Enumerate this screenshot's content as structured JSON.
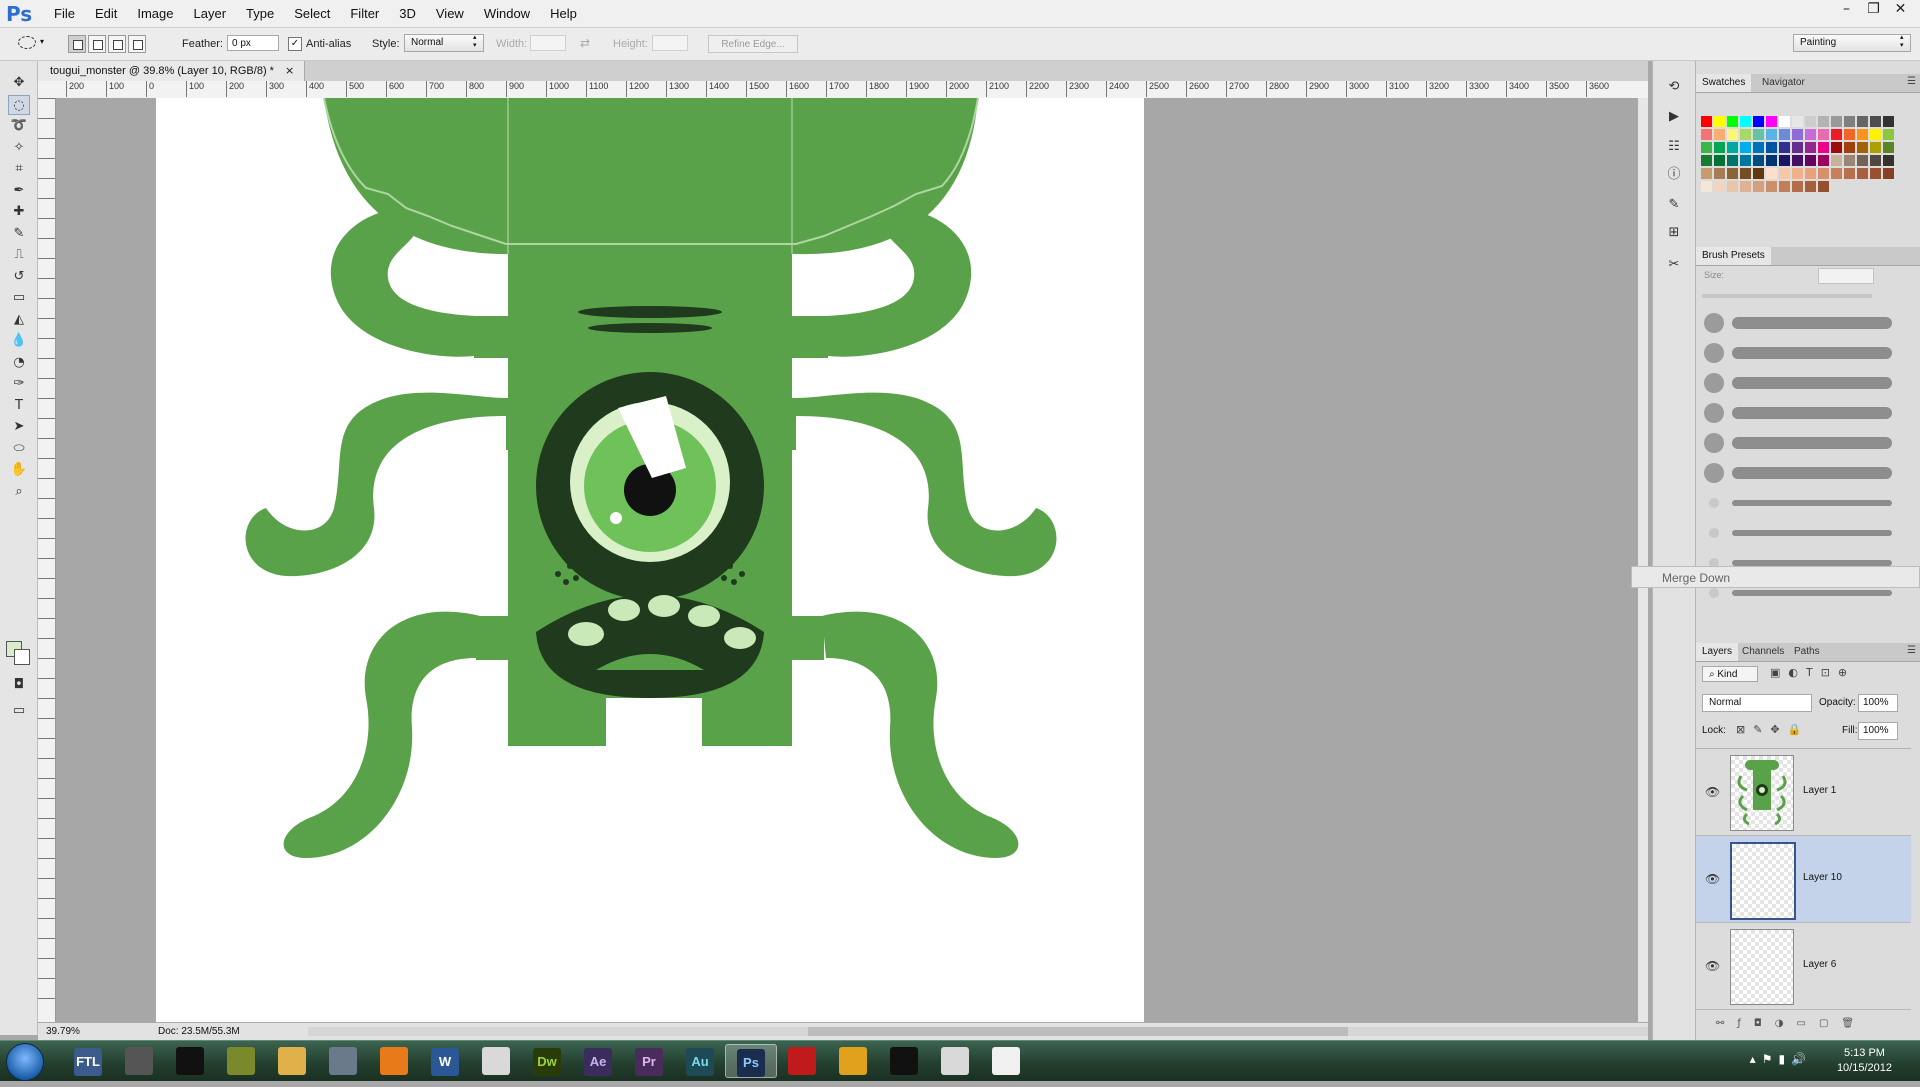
{
  "app": {
    "logo": "Ps"
  },
  "menu": [
    "File",
    "Edit",
    "Image",
    "Layer",
    "Type",
    "Select",
    "Filter",
    "3D",
    "View",
    "Window",
    "Help"
  ],
  "window_controls": {
    "minimize": "–",
    "restore": "❐",
    "close": "✕"
  },
  "options": {
    "feather_label": "Feather:",
    "feather_value": "0 px",
    "antialias_label": "Anti-alias",
    "style_label": "Style:",
    "style_value": "Normal",
    "width_label": "Width:",
    "height_label": "Height:",
    "refine_edge": "Refine Edge...",
    "workspace": "Painting"
  },
  "document": {
    "tab_title": "tougui_monster @ 39.8% (Layer 10, RGB/8) *",
    "zoom": "39.79%",
    "doc_info": "Doc: 23.5M/55.3M"
  },
  "ruler_h": [
    "200",
    "100",
    "0",
    "100",
    "200",
    "300",
    "400",
    "500",
    "600",
    "700",
    "800",
    "900",
    "1000",
    "1100",
    "1200",
    "1300",
    "1400",
    "1500",
    "1600",
    "1700",
    "1800",
    "1900",
    "2000",
    "2100",
    "2200",
    "2300",
    "2400",
    "2500",
    "2600",
    "2700",
    "2800",
    "2900",
    "3000",
    "3100",
    "3200",
    "3300",
    "3400",
    "3500",
    "3600"
  ],
  "ruler_v": [
    "0",
    "1",
    "2",
    "3",
    "4",
    "5",
    "6",
    "7",
    "8",
    "9",
    "1",
    "2",
    "3",
    "4",
    "5",
    "6",
    "7",
    "8",
    "9",
    "2"
  ],
  "swatches_panel": {
    "tabs": [
      "Swatches",
      "Navigator"
    ],
    "colors": [
      "#ff0000",
      "#ffff00",
      "#00ff00",
      "#00ffff",
      "#0000ff",
      "#ff00ff",
      "#ffffff",
      "#e6e6e6",
      "#cccccc",
      "#b3b3b3",
      "#999999",
      "#808080",
      "#666666",
      "#4d4d4d",
      "#333333",
      "#f27474",
      "#f7ad74",
      "#fff57a",
      "#a6d96a",
      "#66c2a5",
      "#5ab4e5",
      "#6b8bd8",
      "#8e6bd8",
      "#c86bd8",
      "#e86bb0",
      "#ed1c24",
      "#f26522",
      "#f7941d",
      "#fff200",
      "#8dc63f",
      "#39b54a",
      "#00a651",
      "#00a99d",
      "#00aeef",
      "#0072bc",
      "#0054a6",
      "#2e3192",
      "#662d91",
      "#92278f",
      "#ec008c",
      "#9e0b0f",
      "#a0410d",
      "#a36209",
      "#aba000",
      "#598527",
      "#197b30",
      "#007236",
      "#00746b",
      "#0076a3",
      "#004b80",
      "#003471",
      "#1b1464",
      "#440e62",
      "#630460",
      "#9e005d",
      "#c7b299",
      "#998675",
      "#736357",
      "#534741",
      "#37302d",
      "#c69c6d",
      "#a67c52",
      "#8c6239",
      "#754c24",
      "#603913",
      "#fde0cc",
      "#f9c7a8",
      "#f2b08a",
      "#eaa07a",
      "#d9906a",
      "#c8805a",
      "#b8704c",
      "#a8603e",
      "#985031",
      "#884024",
      "#f5e6da",
      "#efd5c2",
      "#e8c4ab",
      "#dfb295",
      "#d6a07f",
      "#cc8f6b",
      "#c07e59",
      "#b36e49",
      "#a45f3b",
      "#94512f"
    ]
  },
  "brush_panel": {
    "title": "Brush Presets",
    "size_label": "Size:"
  },
  "tooltip": "Merge Down",
  "layers_panel": {
    "tabs": [
      "Layers",
      "Channels",
      "Paths"
    ],
    "kind": "Kind",
    "blend_mode": "Normal",
    "opacity_label": "Opacity:",
    "opacity_value": "100%",
    "lock_label": "Lock:",
    "fill_label": "Fill:",
    "fill_value": "100%",
    "layers": [
      {
        "name": "Layer 1",
        "selected": false
      },
      {
        "name": "Layer 10",
        "selected": true
      },
      {
        "name": "Layer 6",
        "selected": false
      }
    ]
  },
  "taskbar": {
    "apps": [
      {
        "label": "FTL",
        "icon": "ftl-icon",
        "color": "#3c5a8c"
      },
      {
        "label": "",
        "icon": "pen-tool-icon",
        "color": "#555555"
      },
      {
        "label": "",
        "icon": "terminal-icon",
        "color": "#111111"
      },
      {
        "label": "",
        "icon": "network-icon",
        "color": "#7a8a2a"
      },
      {
        "label": "",
        "icon": "folder-icon",
        "color": "#e0b04a"
      },
      {
        "label": "",
        "icon": "app-manager-icon",
        "color": "#6a7a8a"
      },
      {
        "label": "",
        "icon": "media-player-icon",
        "color": "#e87a1a"
      },
      {
        "label": "W",
        "icon": "word-icon",
        "color": "#2b5797"
      },
      {
        "label": "",
        "icon": "itunes-icon",
        "color": "#d9d9d9"
      },
      {
        "label": "Dw",
        "icon": "dreamweaver-icon",
        "color": "#2a3b0a"
      },
      {
        "label": "Ae",
        "icon": "aftereffects-icon",
        "color": "#3a2c5c"
      },
      {
        "label": "Pr",
        "icon": "premiere-icon",
        "color": "#4a2c5c"
      },
      {
        "label": "Au",
        "icon": "audition-icon",
        "color": "#1d4a55"
      },
      {
        "label": "Ps",
        "icon": "photoshop-icon",
        "color": "#1a2d4d"
      },
      {
        "label": "",
        "icon": "shockwave-icon",
        "color": "#c01a1a"
      },
      {
        "label": "",
        "icon": "fl-studio-icon",
        "color": "#e0a21a"
      },
      {
        "label": "",
        "icon": "razer-icon",
        "color": "#111111"
      },
      {
        "label": "",
        "icon": "chrome-icon",
        "color": "#d9d9d9"
      },
      {
        "label": "",
        "icon": "notepad-icon",
        "color": "#f0f0f0"
      }
    ],
    "time": "5:13 PM",
    "date": "10/15/2012"
  }
}
